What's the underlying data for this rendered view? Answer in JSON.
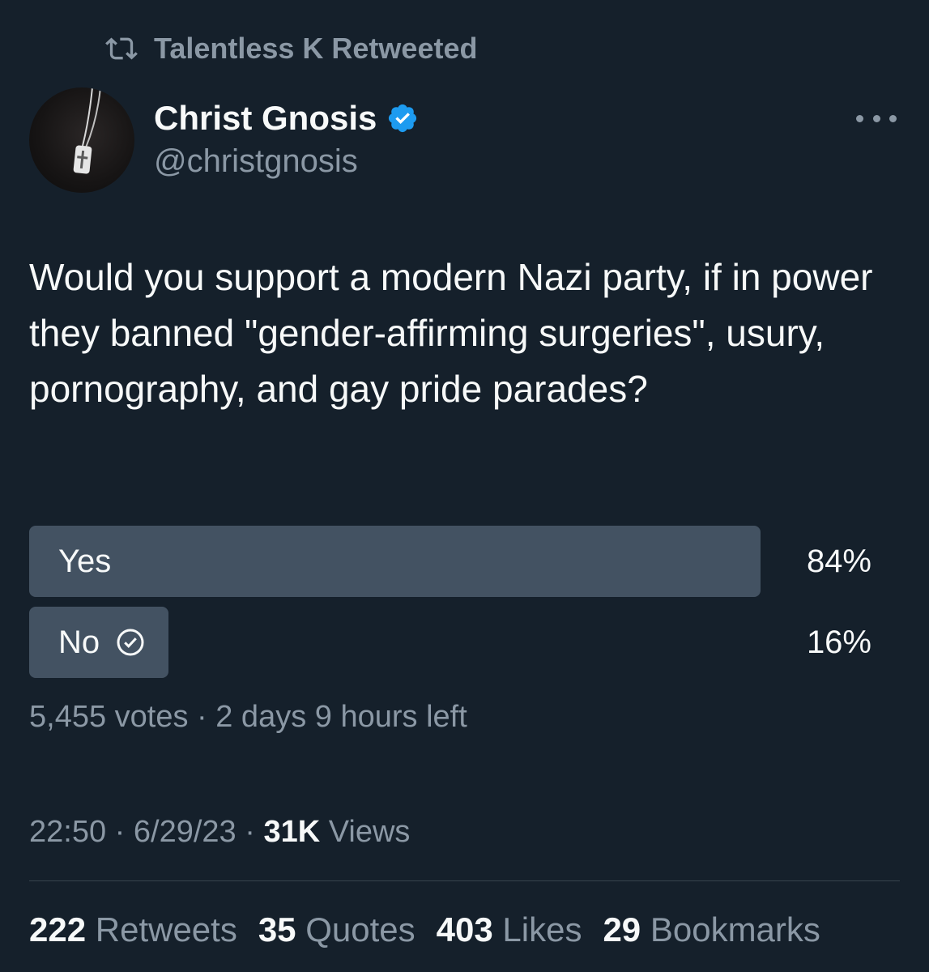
{
  "retweet_banner": {
    "icon": "retweet-icon",
    "text": "Talentless K Retweeted"
  },
  "author": {
    "display_name": "Christ Gnosis",
    "handle": "@christgnosis",
    "verified": true,
    "verified_color": "#1d9bf0"
  },
  "tweet": {
    "text": "Would you support a modern Nazi party, if in power they banned \"gender-affirming surgeries\", usury, pornography, and gay pride parades?"
  },
  "poll": {
    "options": [
      {
        "label": "Yes",
        "percent_text": "84%",
        "share": 0.84,
        "selected": false
      },
      {
        "label": "No",
        "percent_text": "16%",
        "share": 0.16,
        "selected": true
      }
    ],
    "meta": "5,455 votes · 2 days 9 hours left"
  },
  "timestamp": {
    "time": "22:50",
    "date": "6/29/23",
    "views_count": "31K",
    "views_label": "Views"
  },
  "stats": {
    "retweets_count": "222",
    "retweets_label": "Retweets",
    "quotes_count": "35",
    "quotes_label": "Quotes",
    "likes_count": "403",
    "likes_label": "Likes",
    "bookmarks_count": "29",
    "bookmarks_label": "Bookmarks"
  },
  "colors": {
    "background": "#15202b",
    "poll_bar": "#435262",
    "secondary_text": "#8b98a5",
    "primary_text": "#f7f9f9"
  }
}
